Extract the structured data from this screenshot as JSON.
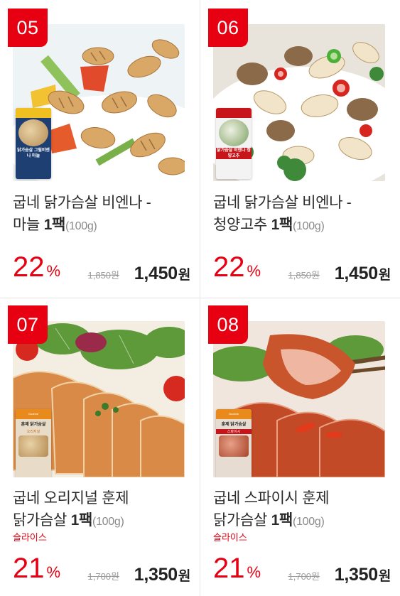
{
  "products": [
    {
      "rank": "05",
      "name_line1": "굽네 닭가슴살 비엔나 -",
      "name_line2": "마늘",
      "pack": "1팩",
      "weight": "(100g)",
      "option": "",
      "discount": "22",
      "discount_unit": "%",
      "original_price": "1,850원",
      "sale_price": "1,450",
      "sale_unit": "원",
      "pouch_text": "닭가슴살 그릴비엔나 마늘",
      "image": "grilled-chicken-vienna-garlic"
    },
    {
      "rank": "06",
      "name_line1": "굽네 닭가슴살 비엔나 -",
      "name_line2": "청양고추",
      "pack": "1팩",
      "weight": "(100g)",
      "option": "",
      "discount": "22",
      "discount_unit": "%",
      "original_price": "1,850원",
      "sale_price": "1,450",
      "sale_unit": "원",
      "pouch_text": "닭가슴살 비엔나 청양고추",
      "image": "chicken-vienna-cheongyang-pepper"
    },
    {
      "rank": "07",
      "name_line1": "굽네 오리지널 훈제",
      "name_line2": "닭가슴살",
      "pack": "1팩",
      "weight": "(100g)",
      "option": "슬라이스",
      "discount": "21",
      "discount_unit": "%",
      "original_price": "1,700원",
      "sale_price": "1,350",
      "sale_unit": "원",
      "pouch_brand": "Goobne",
      "pouch_text": "훈제 닭가슴살",
      "pouch_sub": "오리지널",
      "image": "smoked-chicken-breast-original"
    },
    {
      "rank": "08",
      "name_line1": "굽네 스파이시 훈제",
      "name_line2": "닭가슴살",
      "pack": "1팩",
      "weight": "(100g)",
      "option": "슬라이스",
      "discount": "21",
      "discount_unit": "%",
      "original_price": "1,700원",
      "sale_price": "1,350",
      "sale_unit": "원",
      "pouch_brand": "Goobne",
      "pouch_text": "훈제 닭가슴살",
      "pouch_sub": "스파이시",
      "image": "smoked-chicken-breast-spicy"
    }
  ],
  "colors": {
    "accent": "#e60012",
    "divider": "#e6e6e6",
    "text": "#2a2a2a",
    "muted": "#9a9a9a"
  }
}
